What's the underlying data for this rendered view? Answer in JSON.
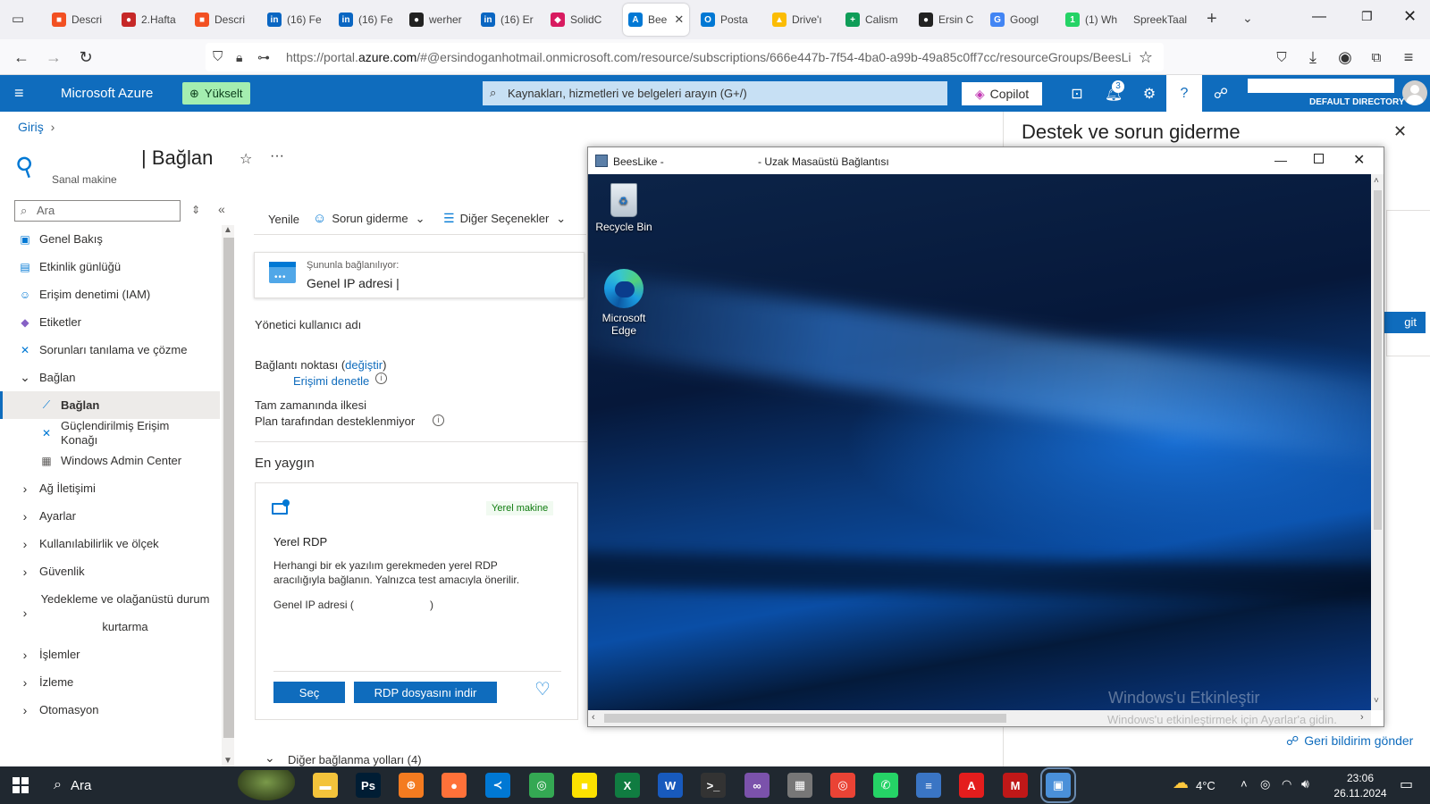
{
  "browser": {
    "tabs": [
      {
        "label": "Descri",
        "color": "#f25022",
        "glyph": "■"
      },
      {
        "label": "2.Hafta",
        "color": "#c62828",
        "glyph": "●"
      },
      {
        "label": "Descri",
        "color": "#f25022",
        "glyph": "■"
      },
      {
        "label": "(16) Fe",
        "color": "#0a66c2",
        "glyph": "in"
      },
      {
        "label": "(16) Fe",
        "color": "#0a66c2",
        "glyph": "in"
      },
      {
        "label": "werher",
        "color": "#222222",
        "glyph": "●"
      },
      {
        "label": "(16) Er",
        "color": "#0a66c2",
        "glyph": "in"
      },
      {
        "label": "SolidC",
        "color": "#d81b60",
        "glyph": "◆"
      },
      {
        "label": "Bee",
        "color": "#0078d4",
        "glyph": "A"
      },
      {
        "label": "Posta",
        "color": "#0078d4",
        "glyph": "O"
      },
      {
        "label": "Drive'ı",
        "color": "#fbbc04",
        "glyph": "▲"
      },
      {
        "label": "Calism",
        "color": "#0f9d58",
        "glyph": "+"
      },
      {
        "label": "Ersin C",
        "color": "#222222",
        "glyph": "●"
      },
      {
        "label": "Googl",
        "color": "#4285f4",
        "glyph": "G"
      },
      {
        "label": "(1) Wh",
        "color": "#25d366",
        "glyph": "1"
      },
      {
        "label": "SpreekTaal",
        "color": "#f0f0f4",
        "glyph": ""
      }
    ],
    "active_tab_index": 8,
    "url_prefix": "https://portal.",
    "url_domain": "azure.com",
    "url_rest": "/#@ersindoganhotmail.onmicrosoft.com/resource/subscriptions/666e447b-7f54-4ba0-a99b-49a85c0ff7cc/resourceGroups/BeesLi"
  },
  "azure": {
    "brand": "Microsoft Azure",
    "upgrade": "Yükselt",
    "search_placeholder": "Kaynakları, hizmetleri ve belgeleri arayın (G+/)",
    "copilot": "Copilot",
    "notifications_count": "3",
    "directory": "DEFAULT DIRECTORY"
  },
  "blade": {
    "breadcrumb": "Giriş",
    "title": "| Bağlan",
    "subtitle": "Sanal makine",
    "search_placeholder": "Ara",
    "nav": [
      {
        "label": "Genel Bakış",
        "icon": "▣",
        "color": "#0078d4",
        "indent": 0,
        "chev": ""
      },
      {
        "label": "Etkinlik günlüğü",
        "icon": "▤",
        "color": "#0078d4",
        "indent": 0,
        "chev": ""
      },
      {
        "label": "Erişim denetimi (IAM)",
        "icon": "☺",
        "color": "#0078d4",
        "indent": 0,
        "chev": ""
      },
      {
        "label": "Etiketler",
        "icon": "◆",
        "color": "#8661c5",
        "indent": 0,
        "chev": ""
      },
      {
        "label": "Sorunları tanılama ve çözme",
        "icon": "✕",
        "color": "#0078d4",
        "indent": 0,
        "chev": ""
      },
      {
        "label": "Bağlan",
        "icon": "",
        "color": "#323130",
        "indent": 0,
        "chev": "⌄"
      },
      {
        "label": "Bağlan",
        "icon": "⟋",
        "color": "#0078d4",
        "indent": 1,
        "chev": "",
        "selected": true
      },
      {
        "label": "Güçlendirilmiş Erişim Konağı",
        "icon": "✕",
        "color": "#0078d4",
        "indent": 1,
        "chev": ""
      },
      {
        "label": "Windows Admin Center",
        "icon": "▦",
        "color": "#605e5c",
        "indent": 1,
        "chev": ""
      },
      {
        "label": "Ağ İletişimi",
        "icon": "",
        "color": "#323130",
        "indent": 0,
        "chev": "›"
      },
      {
        "label": "Ayarlar",
        "icon": "",
        "color": "#323130",
        "indent": 0,
        "chev": "›"
      },
      {
        "label": "Kullanılabilirlik ve ölçek",
        "icon": "",
        "color": "#323130",
        "indent": 0,
        "chev": "›"
      },
      {
        "label": "Güvenlik",
        "icon": "",
        "color": "#323130",
        "indent": 0,
        "chev": "›"
      },
      {
        "label": "Yedekleme ve olağanüstü durum kurtarma",
        "icon": "",
        "color": "#323130",
        "indent": 0,
        "chev": "›",
        "tall": true
      },
      {
        "label": "İşlemler",
        "icon": "",
        "color": "#323130",
        "indent": 0,
        "chev": "›"
      },
      {
        "label": "İzleme",
        "icon": "",
        "color": "#323130",
        "indent": 0,
        "chev": "›"
      },
      {
        "label": "Otomasyon",
        "icon": "",
        "color": "#323130",
        "indent": 0,
        "chev": "›"
      }
    ]
  },
  "toolbar": {
    "refresh": "Yenile",
    "troubleshoot": "Sorun giderme",
    "more_options": "Diğer Seçenekler"
  },
  "connect": {
    "connecting_to_label": "Şununla bağlanılıyor:",
    "connecting_to_value": "Genel IP adresi |",
    "admin_user": "Yönetici kullanıcı adı",
    "port_label": "Bağlantı noktası (",
    "port_change": "değiştir",
    "port_end": ")",
    "check_access": "Erişimi denetle",
    "jit_line1": "Tam zamanında ilkesi",
    "jit_line2": "Plan tarafından desteklenmiyor",
    "most_common": "En yaygın",
    "card_badge": "Yerel makine",
    "card_title": "Yerel RDP",
    "card_desc1": "Herhangi bir ek yazılım gerekmeden yerel RDP",
    "card_desc2": "aracılığıyla bağlanın. Yalnızca test amacıyla önerilir.",
    "card_ip_open": "Genel IP adresi (",
    "card_ip_close": ")",
    "select_btn": "Seç",
    "download_btn": "RDP dosyasını indir",
    "other_ways": "Diğer bağlanma yolları (4)"
  },
  "right_panel": {
    "title": "Destek ve sorun giderme",
    "partial_btn": "git",
    "feedback": "Geri bildirim gönder"
  },
  "rdp_window": {
    "title_left": "BeesLike -",
    "title_right": "- Uzak Masaüstü Bağlantısı",
    "desktop_icons": [
      "Recycle Bin",
      "Microsoft Edge"
    ],
    "watermark_title": "Windows'u Etkinleştir",
    "watermark_sub": "Windows'u etkinleştirmek için Ayarlar'a gidin."
  },
  "taskbar": {
    "search": "Ara",
    "weather": "4°C",
    "time": "23:06",
    "date": "26.11.2024",
    "apps": [
      {
        "name": "file-explorer",
        "color": "#f3c33b",
        "glyph": "▬"
      },
      {
        "name": "photoshop",
        "color": "#001d34",
        "glyph": "Ps"
      },
      {
        "name": "hotspot-app",
        "color": "#f47b20",
        "glyph": "⊕"
      },
      {
        "name": "firefox",
        "color": "#ff7139",
        "glyph": "●"
      },
      {
        "name": "vscode",
        "color": "#0078d4",
        "glyph": "≺"
      },
      {
        "name": "chrome",
        "color": "#34a853",
        "glyph": "◎"
      },
      {
        "name": "sticky-notes",
        "color": "#fce100",
        "glyph": "■"
      },
      {
        "name": "excel",
        "color": "#107c41",
        "glyph": "X"
      },
      {
        "name": "word",
        "color": "#185abd",
        "glyph": "W"
      },
      {
        "name": "terminal",
        "color": "#333333",
        "glyph": ">_"
      },
      {
        "name": "visual-studio",
        "color": "#7b52ab",
        "glyph": "∞"
      },
      {
        "name": "network-app",
        "color": "#777777",
        "glyph": "▦"
      },
      {
        "name": "chrome-2",
        "color": "#ea4335",
        "glyph": "◎"
      },
      {
        "name": "whatsapp",
        "color": "#25d366",
        "glyph": "✆"
      },
      {
        "name": "gambia-flag-app",
        "color": "#3a75c4",
        "glyph": "≡"
      },
      {
        "name": "acrobat",
        "color": "#e41d1d",
        "glyph": "A"
      },
      {
        "name": "mcafee",
        "color": "#c01818",
        "glyph": "M"
      },
      {
        "name": "remote-desktop",
        "color": "#4a90d9",
        "glyph": "▣"
      }
    ]
  }
}
